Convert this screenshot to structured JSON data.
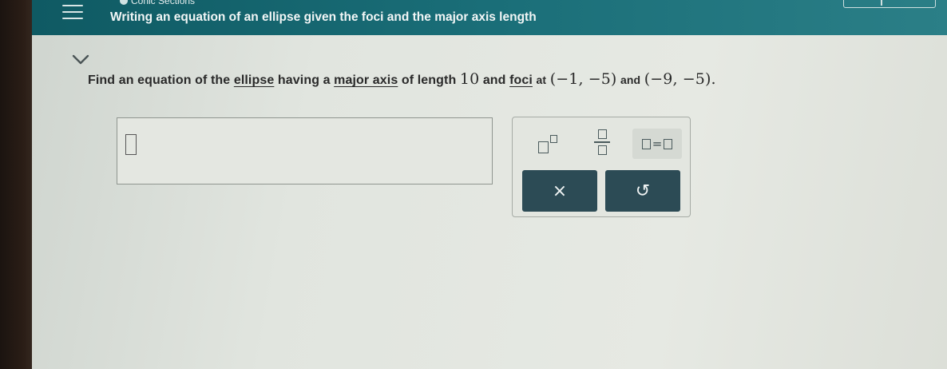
{
  "header": {
    "section_label": "Conic Sections",
    "title": "Writing an equation of an ellipse given the foci and the major axis length"
  },
  "question": {
    "part1": "Find an equation of the",
    "link_ellipse": "ellipse",
    "part2": "having a",
    "link_major_axis": "major axis",
    "part3": "of length",
    "length_value": "10",
    "part4": "and",
    "link_foci": "foci",
    "part5": "at",
    "point1": "(−1, −5)",
    "part6": "and",
    "point2": "(−9, −5)."
  },
  "answer": {
    "value": ""
  },
  "keypad": {
    "clear_symbol": "×",
    "undo_symbol": "↺",
    "equals_symbol": "="
  },
  "icons": {
    "menu": "hamburger-menu-icon",
    "chevron": "chevron-down-icon",
    "superscript": "superscript-template-icon",
    "fraction": "fraction-template-icon",
    "equation": "equation-template-icon",
    "clear": "clear-icon",
    "undo": "undo-icon"
  },
  "colors": {
    "header_bg": "#1a6e78",
    "keypad_button_bg": "#2c4b55",
    "page_bg": "#e1e5df"
  }
}
